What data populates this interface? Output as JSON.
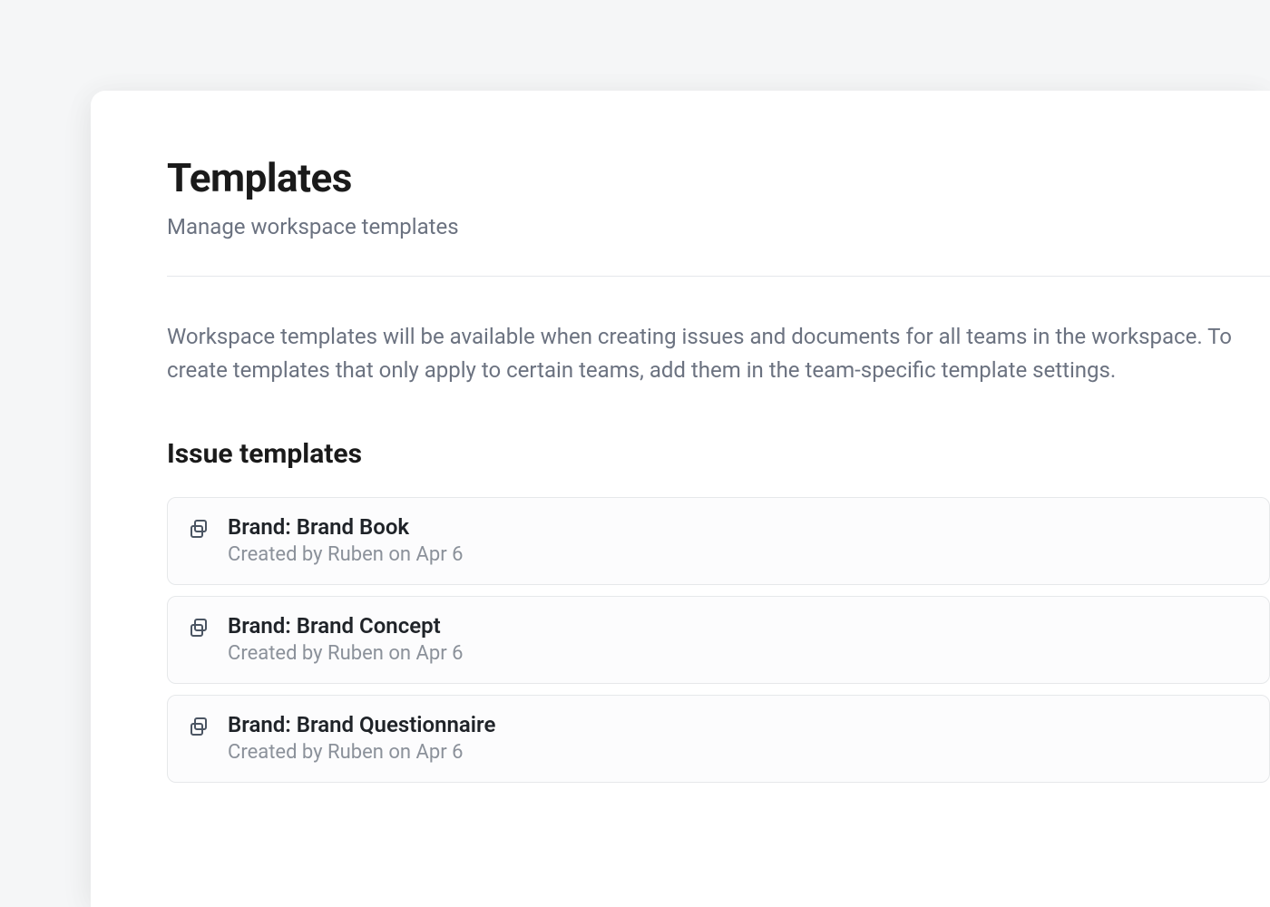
{
  "header": {
    "title": "Templates",
    "subtitle": "Manage workspace templates"
  },
  "description": "Workspace templates will be available when creating issues and documents for all teams in the workspace. To create templates that only apply to certain teams, add them in the team-specific template settings.",
  "section": {
    "title": "Issue templates"
  },
  "templates": [
    {
      "name": "Brand: Brand Book",
      "meta": "Created by Ruben on Apr 6"
    },
    {
      "name": "Brand: Brand Concept",
      "meta": "Created by Ruben on Apr 6"
    },
    {
      "name": "Brand: Brand Questionnaire",
      "meta": "Created by Ruben on Apr 6"
    }
  ]
}
